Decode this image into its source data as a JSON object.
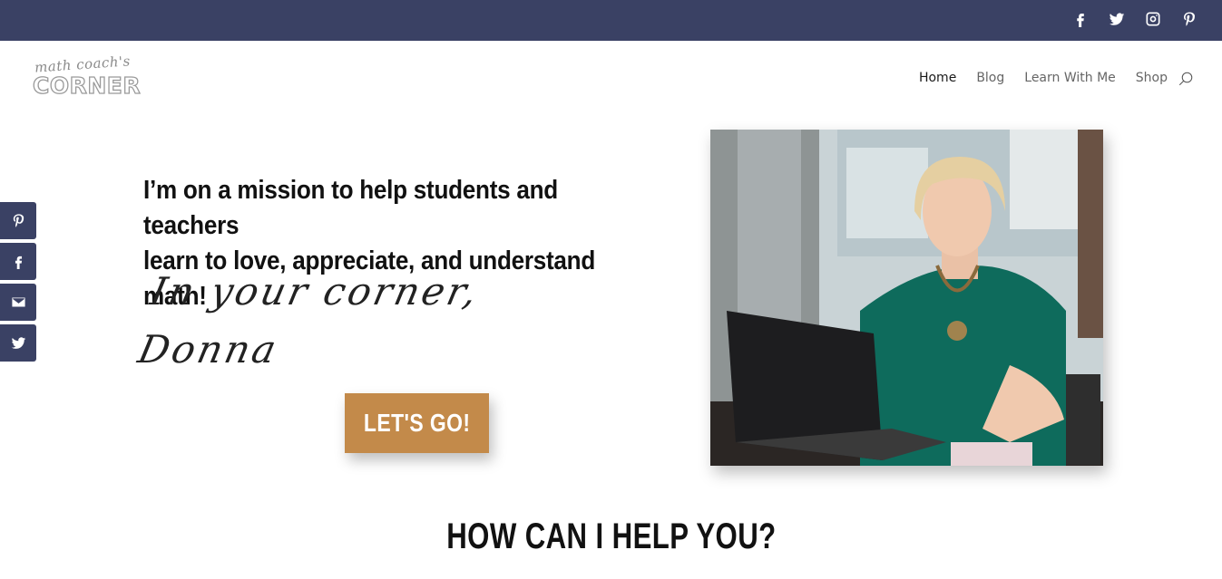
{
  "header": {
    "social_icons": [
      "facebook-icon",
      "twitter-icon",
      "instagram-icon",
      "pinterest-icon"
    ],
    "bar_color": "#3a4164"
  },
  "logo": {
    "script": "math coach's",
    "main": "CORNER"
  },
  "nav": {
    "items": [
      {
        "label": "Home",
        "active": true
      },
      {
        "label": "Blog",
        "active": false
      },
      {
        "label": "Learn With Me",
        "active": false
      },
      {
        "label": "Shop",
        "active": false
      }
    ],
    "search_icon": "search-icon"
  },
  "side_share": [
    "pinterest-icon",
    "facebook-icon",
    "email-icon",
    "twitter-icon"
  ],
  "hero": {
    "mission_line1": "I’m on a mission to help students and teachers",
    "mission_line2": "learn to love, appreciate, and understand math!",
    "signature_line1": "In your corner,",
    "signature_line2": "Donna",
    "cta_label": "LET'S GO!",
    "cta_color": "#c38a4a"
  },
  "section": {
    "heading": "HOW CAN I HELP YOU?"
  }
}
